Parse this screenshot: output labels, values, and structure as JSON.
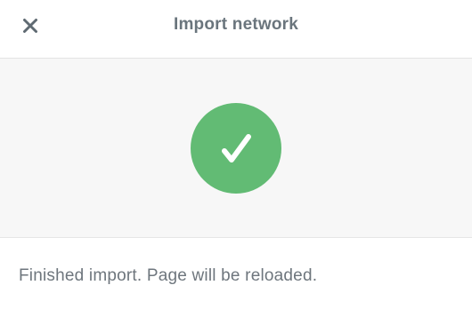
{
  "dialog": {
    "title": "Import network",
    "close_icon": "close-icon",
    "status_icon": "checkmark-icon",
    "status": "success",
    "message": "Finished import. Page will be reloaded."
  },
  "colors": {
    "title": "#6a757d",
    "success": "#62bb74",
    "status_background": "#f7f7f7",
    "message": "#6e767d"
  }
}
